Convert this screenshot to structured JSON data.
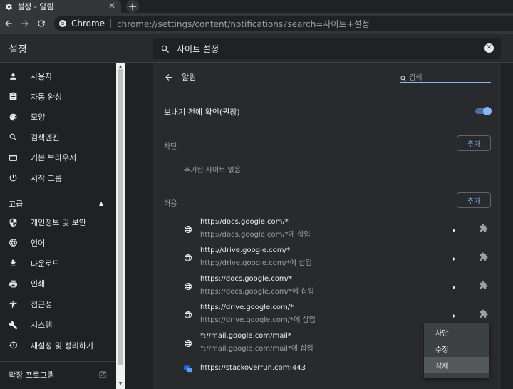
{
  "tab": {
    "title": "설정 - 알림",
    "close": "✕",
    "newtab": "+"
  },
  "omnibox": {
    "chip": "Chrome",
    "url": "chrome://settings/content/notifications?search=사이트+설정"
  },
  "header": {
    "title": "설정",
    "search_value": "사이트 설정"
  },
  "sidebar": {
    "items": [
      {
        "label": "사용자",
        "icon": "person-icon"
      },
      {
        "label": "자동 완성",
        "icon": "clipboard-icon"
      },
      {
        "label": "모양",
        "icon": "palette-icon"
      },
      {
        "label": "검색엔진",
        "icon": "search-icon"
      },
      {
        "label": "기본 브라우저",
        "icon": "browser-window-icon"
      },
      {
        "label": "시작 그룹",
        "icon": "power-icon"
      }
    ],
    "advanced_label": "고급",
    "advanced_items": [
      {
        "label": "개인정보 및 보안",
        "icon": "shield-icon"
      },
      {
        "label": "언어",
        "icon": "globe-icon"
      },
      {
        "label": "다운로드",
        "icon": "download-icon"
      },
      {
        "label": "인쇄",
        "icon": "printer-icon"
      },
      {
        "label": "접근성",
        "icon": "accessibility-icon"
      },
      {
        "label": "시스템",
        "icon": "wrench-icon"
      },
      {
        "label": "재설정 및 정리하기",
        "icon": "history-icon"
      }
    ],
    "extensions_label": "확장 프로그램"
  },
  "page": {
    "title": "알림",
    "search_placeholder": "검색",
    "ask_label": "보내기 전에 확인(권장)",
    "block_heading": "차단",
    "add_label": "추가",
    "no_sites": "추가된 사이트 없음",
    "allow_heading": "허용"
  },
  "sites": [
    {
      "name": "http://docs.google.com/*",
      "sub": "http://docs.google.com/*에 삽입"
    },
    {
      "name": "http://drive.google.com/*",
      "sub": "http://drive.google.com/*에 삽입"
    },
    {
      "name": "https://docs.google.com/*",
      "sub": "https://docs.google.com/*에 삽입"
    },
    {
      "name": "https://drive.google.com/*",
      "sub": "https://drive.google.com/*에 삽입"
    },
    {
      "name": "*://mail.google.com/mail*",
      "sub": "*://mail.google.com/mail*에 삽입"
    },
    {
      "name": "https://stackoverrun.com:443",
      "sub": ""
    }
  ],
  "context_menu": {
    "items": [
      "차단",
      "수정",
      "삭제"
    ],
    "highlighted": "삭제"
  },
  "colors": {
    "accent": "#8ab4f8",
    "background": "#202124",
    "card": "#292a2d"
  }
}
